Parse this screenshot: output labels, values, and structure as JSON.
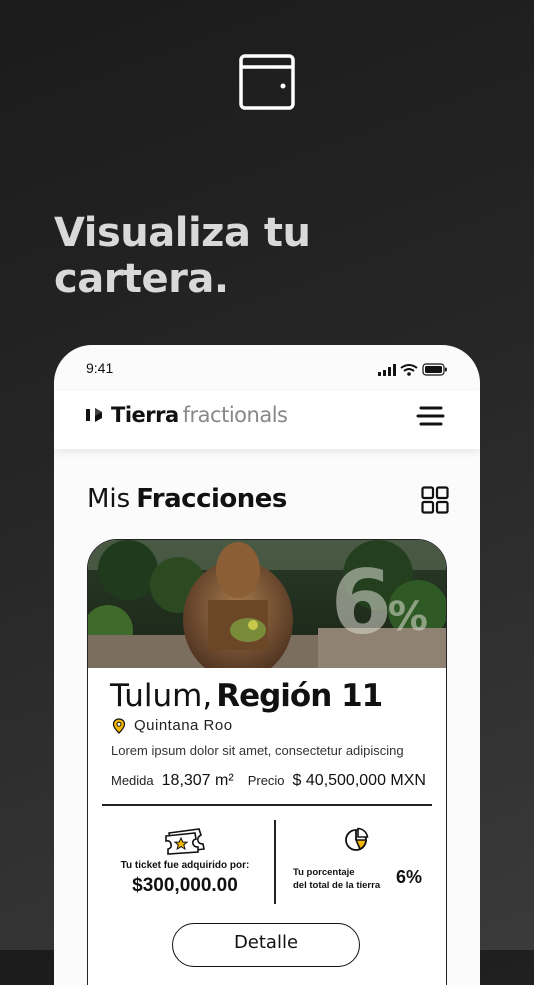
{
  "promo": {
    "headline_line1": "Visualiza tu",
    "headline_line2": "cartera.",
    "icon": "wallet-icon"
  },
  "status_bar": {
    "time": "9:41"
  },
  "header": {
    "brand_name": "Tierra",
    "brand_sub": "fractionals",
    "menu_icon": "hamburger-menu-icon"
  },
  "section": {
    "title_light": "Mis",
    "title_bold": "Fracciones",
    "view_icon": "grid-view-icon"
  },
  "card": {
    "image_overlay_percent": "6",
    "image_overlay_sign": "%",
    "title_light": "Tulum,",
    "title_bold": "Región 11",
    "location": "Quintana Roo",
    "description": "Lorem ipsum dolor sit amet, consectetur adipiscing",
    "medida_label": "Medida",
    "medida_value": "18,307 m²",
    "precio_label": "Precio",
    "precio_value": "$ 40,500,000 MXN",
    "ticket_label": "Tu ticket fue adquirido por:",
    "ticket_amount": "$300,000.00",
    "percentage_label_line1": "Tu porcentaje",
    "percentage_label_line2": "del total de la tierra",
    "percentage_value": "6%",
    "detail_button": "Detalle"
  },
  "colors": {
    "accent": "#f2b705",
    "text": "#111111",
    "background_dark": "#222222"
  }
}
